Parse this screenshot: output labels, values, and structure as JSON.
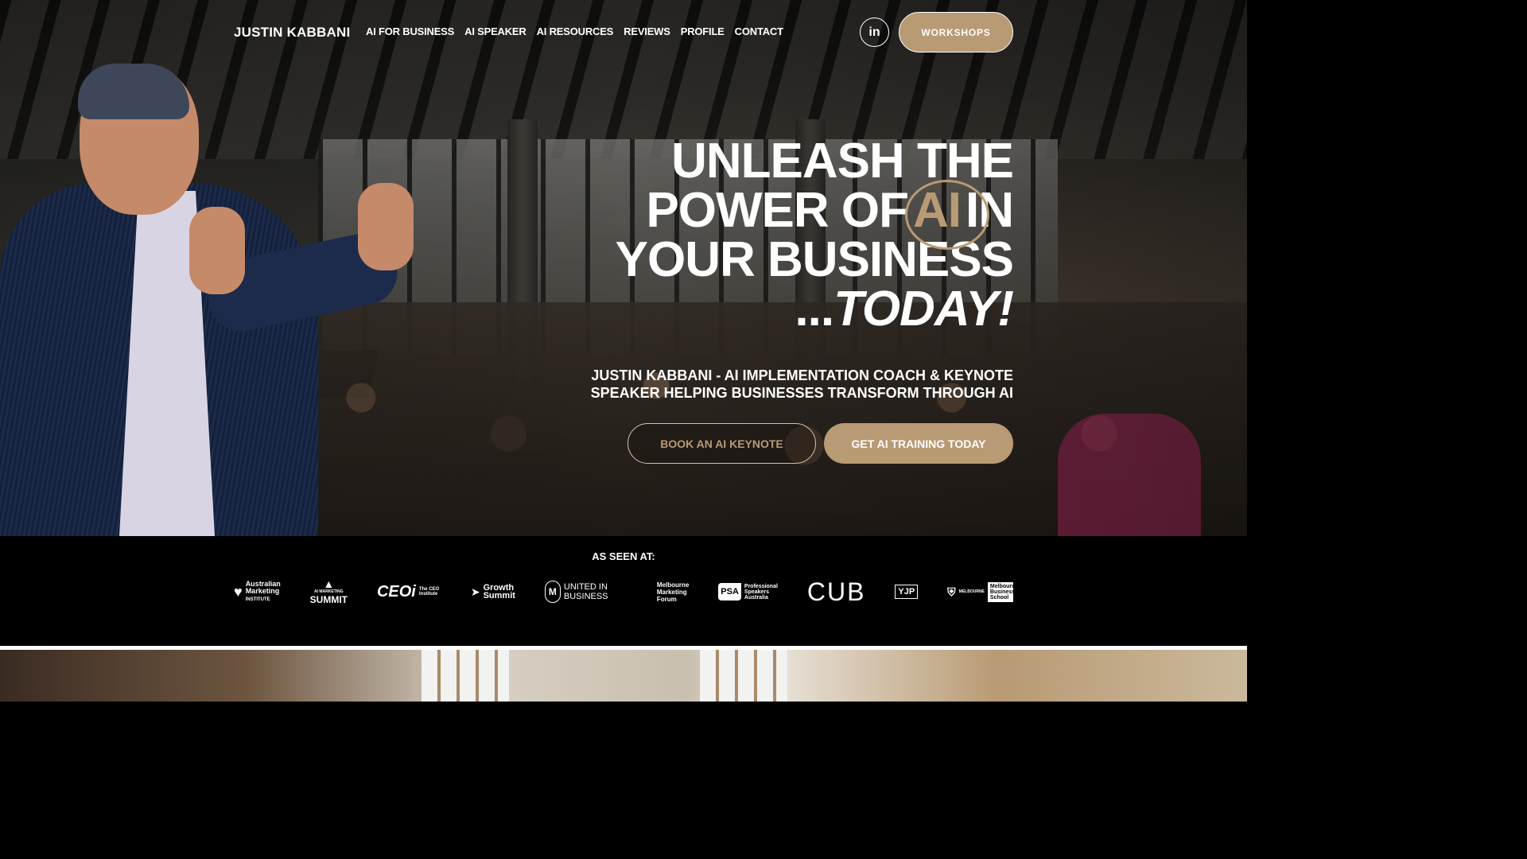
{
  "nav": {
    "brand": "JUSTIN KABBANI",
    "links": [
      "AI FOR BUSINESS",
      "AI SPEAKER",
      "AI RESOURCES",
      "REVIEWS",
      "PROFILE",
      "CONTACT"
    ],
    "linkedin_icon_text": "in",
    "workshops_label": "WORKSHOPS"
  },
  "hero": {
    "line1": "UNLEASH THE",
    "line2_pre": "POWER OF",
    "line2_ai": "AI",
    "line2_post": "IN",
    "line3": "YOUR BUSINESS",
    "line4_dots": "...",
    "line4_today": "TODAY!",
    "subtitle_line1": "JUSTIN KABBANI - AI IMPLEMENTATION COACH & KEYNOTE",
    "subtitle_line2": "SPEAKER HELPING BUSINESSES TRANSFORM THROUGH AI",
    "cta_secondary": "BOOK AN AI KEYNOTE",
    "cta_primary": "GET AI TRAINING TODAY"
  },
  "seen_at": {
    "label": "AS SEEN AT:",
    "logos": {
      "ami_1": "Australian",
      "ami_2": "Marketing",
      "ami_3": "INSTITUTE",
      "summit_1": "AI MARKETING",
      "summit_2": "SUMMIT",
      "ceo_main": "CEOi",
      "ceo_small": "The CEO Institute",
      "growth_1": "Growth",
      "growth_2": "Summit",
      "united": "UNITED IN BUSINESS",
      "mmf_1": "Melbourne",
      "mmf_2": "Marketing",
      "mmf_3": "Forum",
      "psa_box": "PSA",
      "psa_text": "Professional Speakers Australia",
      "cub": "CUB",
      "yjp": "YJP",
      "mbs_left": "MELBOURNE",
      "mbs_box": "Melbourne Business School"
    }
  },
  "colors": {
    "accent": "#b89a74",
    "background": "#000000",
    "text": "#ffffff"
  },
  "icons": [
    "linkedin-icon"
  ]
}
